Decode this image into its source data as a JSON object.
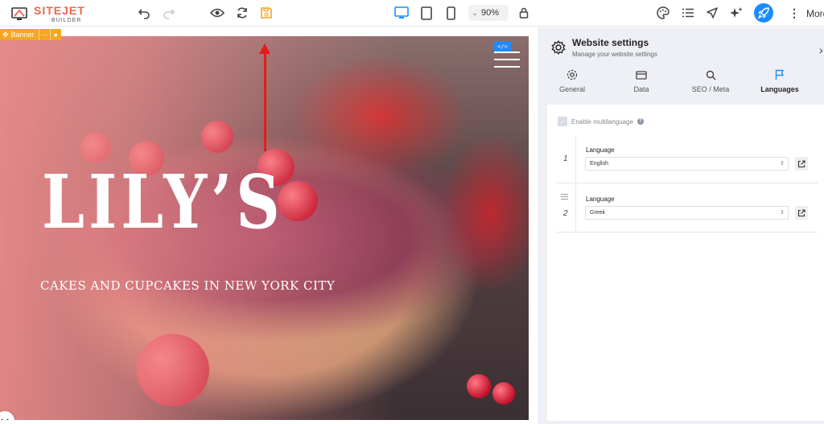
{
  "brand": {
    "title": "SITEJET",
    "subtitle": "BUILDER"
  },
  "toolbar": {
    "zoom": "90%",
    "more_label": "More",
    "icons": [
      "undo-icon",
      "redo-icon",
      "eye-icon",
      "refresh-icon",
      "save-icon",
      "desktop-icon",
      "tablet-icon",
      "mobile-icon",
      "lock-icon",
      "palette-icon",
      "list-icon",
      "navigate-icon",
      "sparkle-icon",
      "rocket-icon"
    ]
  },
  "canvas": {
    "banner_tag": "Banner",
    "hero_title": "LILY’S",
    "hero_subtitle": "CAKES AND CUPCAKES IN NEW YORK CITY",
    "code_badge": "</>"
  },
  "panel": {
    "title": "Website settings",
    "subtitle": "Manage your website settings",
    "tabs": [
      {
        "label": "General",
        "icon": "gear-icon"
      },
      {
        "label": "Data",
        "icon": "card-icon"
      },
      {
        "label": "SEO / Meta",
        "icon": "search-icon"
      },
      {
        "label": "Languages",
        "icon": "flag-icon",
        "active": true
      }
    ],
    "multilanguage_label": "Enable multilanguage",
    "languages": [
      {
        "index": "1",
        "label": "Language",
        "value": "English"
      },
      {
        "index": "2",
        "label": "Language",
        "value": "Greek"
      }
    ]
  },
  "colors": {
    "brand": "#f0644b",
    "accent": "#1a8cff",
    "save_highlight": "#f5a623",
    "annotation_arrow": "#e21d1d"
  }
}
